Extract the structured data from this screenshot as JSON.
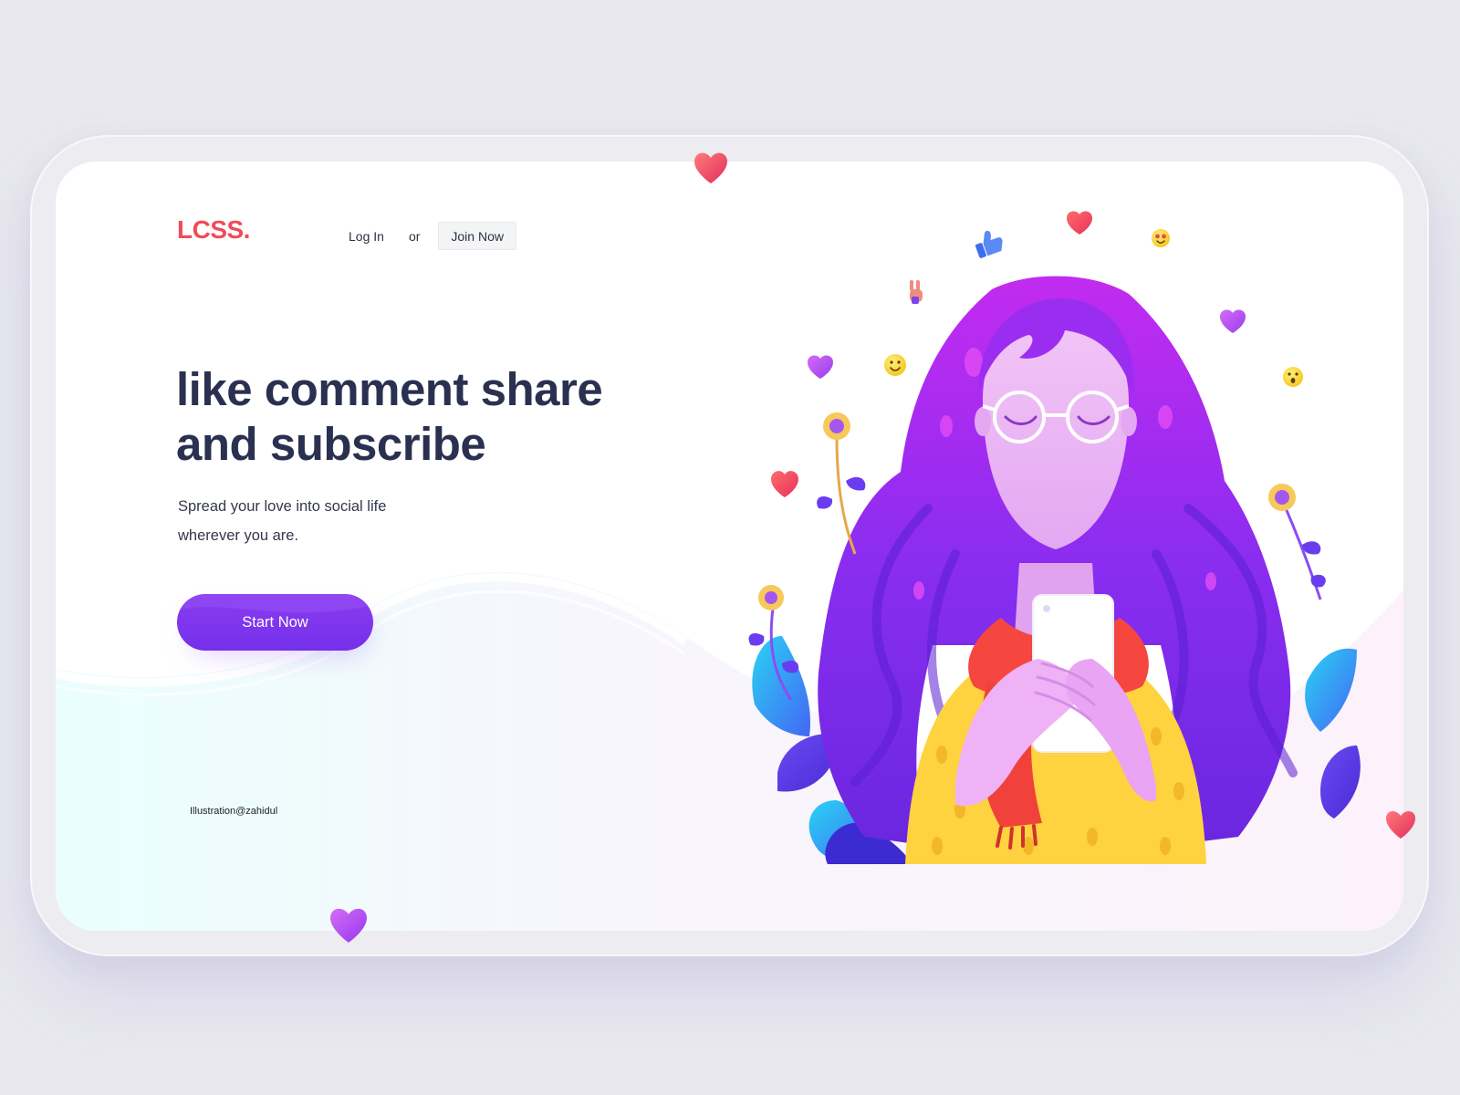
{
  "brand": {
    "logo_text": "LCSS."
  },
  "nav": {
    "login_label": "Log In",
    "separator_label": "or",
    "join_label": "Join Now"
  },
  "hero": {
    "headline_line1": "like comment share",
    "headline_line2": "and subscribe",
    "subtext_line1": "Spread your love into social life",
    "subtext_line2": "wherever you are.",
    "cta_label": "Start Now"
  },
  "footer": {
    "credit": "Illustration@zahidul"
  },
  "colors": {
    "page_background": "#e8e8ee",
    "logo_red": "#f04b58",
    "headline_navy": "#2a3150",
    "cta_purple": "#7a34ee",
    "hair_purple": "#7b2ff0",
    "sweater_yellow": "#ffd23f",
    "scarf_red": "#f5463f"
  },
  "icons": [
    "heart-icon",
    "thumbs-up-icon",
    "peace-hand-icon",
    "smile-emoji-icon",
    "heart-eyes-emoji-icon",
    "surprised-emoji-icon"
  ]
}
